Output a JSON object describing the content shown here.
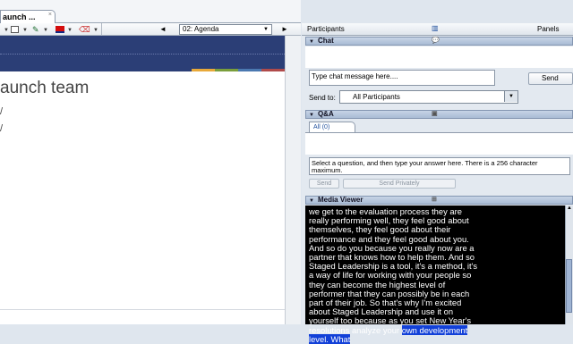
{
  "document": {
    "tab_title": "aunch ...",
    "tab_close": "×",
    "toolbar": {
      "slide_select": "02: Agenda",
      "prev_glyph": "◄",
      "next_glyph": "►"
    },
    "slide": {
      "title": "aunch team",
      "tick1": "/",
      "tick2": "/"
    }
  },
  "right_panel": {
    "participants_label": "Participants",
    "panels_label": "Panels",
    "chat": {
      "header": "Chat",
      "input_placeholder": "Type chat message here....",
      "send_label": "Send",
      "send_to_label": "Send to:",
      "send_to_value": "All Participants"
    },
    "qa": {
      "header": "Q&A",
      "tab_label": "All (0)",
      "input_placeholder": "Select a question, and then type your answer here. There is a 256 character maximum.",
      "send_label": "Send",
      "send_private_label": "Send Privately"
    },
    "media_viewer": {
      "header": "Media Viewer",
      "caption_lines": [
        "we get to the evaluation process they are",
        "really performing well, they feel good about",
        "themselves, they feel good about their",
        "performance and they feel good about you.",
        "And so do you because you really now are a",
        "partner that knows how to help them. And so",
        "Staged Leadership is a tool, it's a method, it's",
        "a way of life for working with your people so",
        "they can become the highest level of",
        "performer that they can possibly be in each",
        "part of their job. So that's why I'm excited",
        "about Staged Leadership and use it on",
        "yourself too because as you set New Year's"
      ],
      "caption_last_plain": "resolutions analyze your ",
      "caption_highlight": "own development",
      "caption_highlight2": "level. What"
    }
  },
  "colors": {
    "banner": "#2b3e76",
    "highlight": "#1240d8",
    "panel_header": "#b8c8de"
  }
}
